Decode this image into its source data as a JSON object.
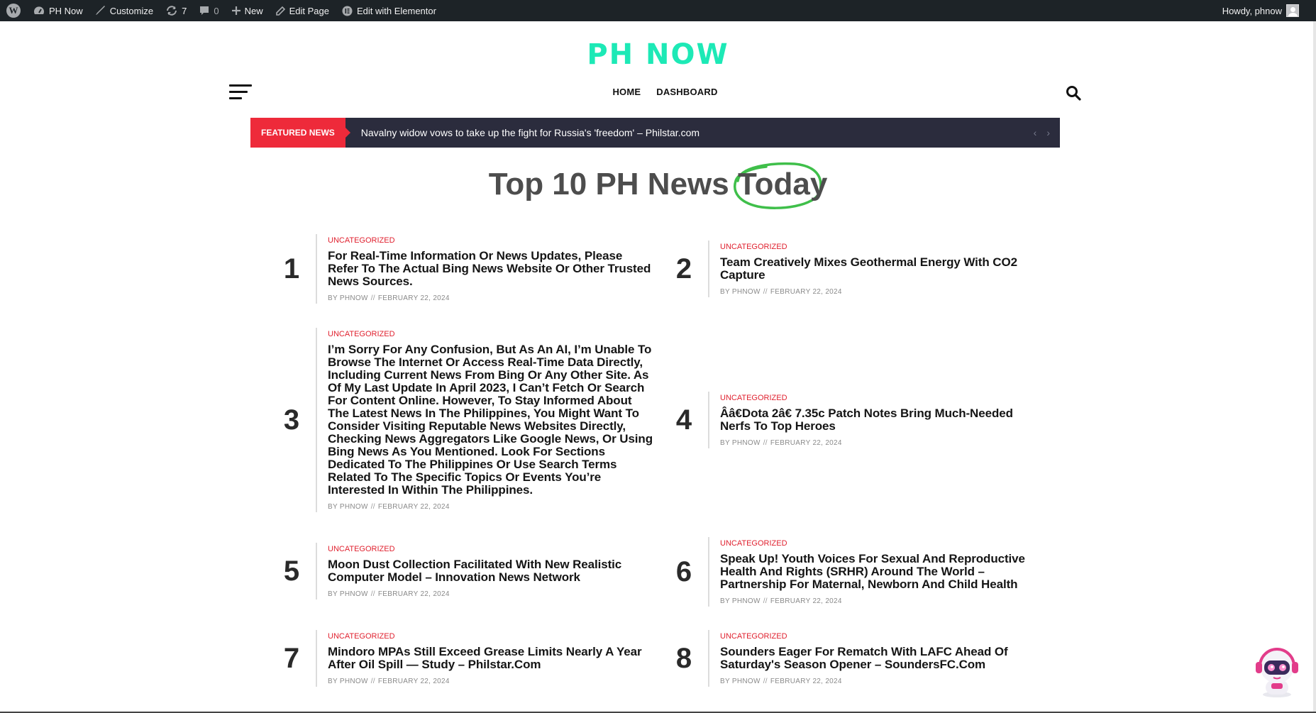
{
  "admin_bar": {
    "wp_logo": "W",
    "site_name": "PH Now",
    "customize": "Customize",
    "updates_count": "7",
    "comments_count": "0",
    "new": "New",
    "edit_page": "Edit Page",
    "edit_elementor": "Edit with Elementor",
    "howdy": "Howdy, phnow"
  },
  "header": {
    "site_title": "PH NOW",
    "nav": [
      "HOME",
      "DASHBOARD"
    ]
  },
  "ticker": {
    "label": "FEATURED NEWS",
    "headline": "Navalny widow vows to take up the fight for Russia's 'freedom' – Philstar.com",
    "prev": "‹",
    "next": "›"
  },
  "page_heading": {
    "main": "Top 10 PH News",
    "highlight": "Today",
    "highlight_color": "#3fbf4a"
  },
  "posts": [
    {
      "num": "1",
      "category": "UNCATEGORIZED",
      "title": "For Real-Time Information Or News Updates, Please Refer To The Actual Bing News Website Or Other Trusted News Sources.",
      "by": "BY",
      "author": "PHNOW",
      "sep": "//",
      "date": "FEBRUARY 22, 2024"
    },
    {
      "num": "2",
      "category": "UNCATEGORIZED",
      "title": "Team Creatively Mixes Geothermal Energy With CO2 Capture",
      "by": "BY",
      "author": "PHNOW",
      "sep": "//",
      "date": "FEBRUARY 22, 2024"
    },
    {
      "num": "3",
      "category": "UNCATEGORIZED",
      "title": "I’m Sorry For Any Confusion, But As An AI, I’m Unable To Browse The Internet Or Access Real-Time Data Directly, Including Current News From Bing Or Any Other Site. As Of My Last Update In April 2023, I Can’t Fetch Or Search For Content Online. However, To Stay Informed About The Latest News In The Philippines, You Might Want To Consider Visiting Reputable News Websites Directly, Checking News Aggregators Like Google News, Or Using Bing News As You Mentioned. Look For Sections Dedicated To The Philippines Or Use Search Terms Related To The Specific Topics Or Events You’re Interested In Within The Philippines.",
      "by": "BY",
      "author": "PHNOW",
      "sep": "//",
      "date": "FEBRUARY 22, 2024"
    },
    {
      "num": "4",
      "category": "UNCATEGORIZED",
      "title": "Ââ€Dota 2â€ 7.35c Patch Notes Bring Much-Needed Nerfs To Top Heroes",
      "by": "BY",
      "author": "PHNOW",
      "sep": "//",
      "date": "FEBRUARY 22, 2024"
    },
    {
      "num": "5",
      "category": "UNCATEGORIZED",
      "title": "Moon Dust Collection Facilitated With New Realistic Computer Model – Innovation News Network",
      "by": "BY",
      "author": "PHNOW",
      "sep": "//",
      "date": "FEBRUARY 22, 2024"
    },
    {
      "num": "6",
      "category": "UNCATEGORIZED",
      "title": "Speak Up! Youth Voices For Sexual And Reproductive Health And Rights (SRHR) Around The World – Partnership For Maternal, Newborn And Child Health",
      "by": "BY",
      "author": "PHNOW",
      "sep": "//",
      "date": "FEBRUARY 22, 2024"
    },
    {
      "num": "7",
      "category": "UNCATEGORIZED",
      "title": "Mindoro MPAs Still Exceed Grease Limits Nearly A Year After Oil Spill — Study – Philstar.Com",
      "by": "BY",
      "author": "PHNOW",
      "sep": "//",
      "date": "FEBRUARY 22, 2024"
    },
    {
      "num": "8",
      "category": "UNCATEGORIZED",
      "title": "Sounders Eager For Rematch With LAFC Ahead Of Saturday's Season Opener – SoundersFC.Com",
      "by": "BY",
      "author": "PHNOW",
      "sep": "//",
      "date": "FEBRUARY 22, 2024"
    }
  ],
  "colors": {
    "admin_bar_bg": "#1d2327",
    "site_title": "#1de9b6",
    "ticker_bg": "#2b2c3d",
    "ticker_label_bg": "#ee2a3a",
    "category": "#e0212f"
  }
}
